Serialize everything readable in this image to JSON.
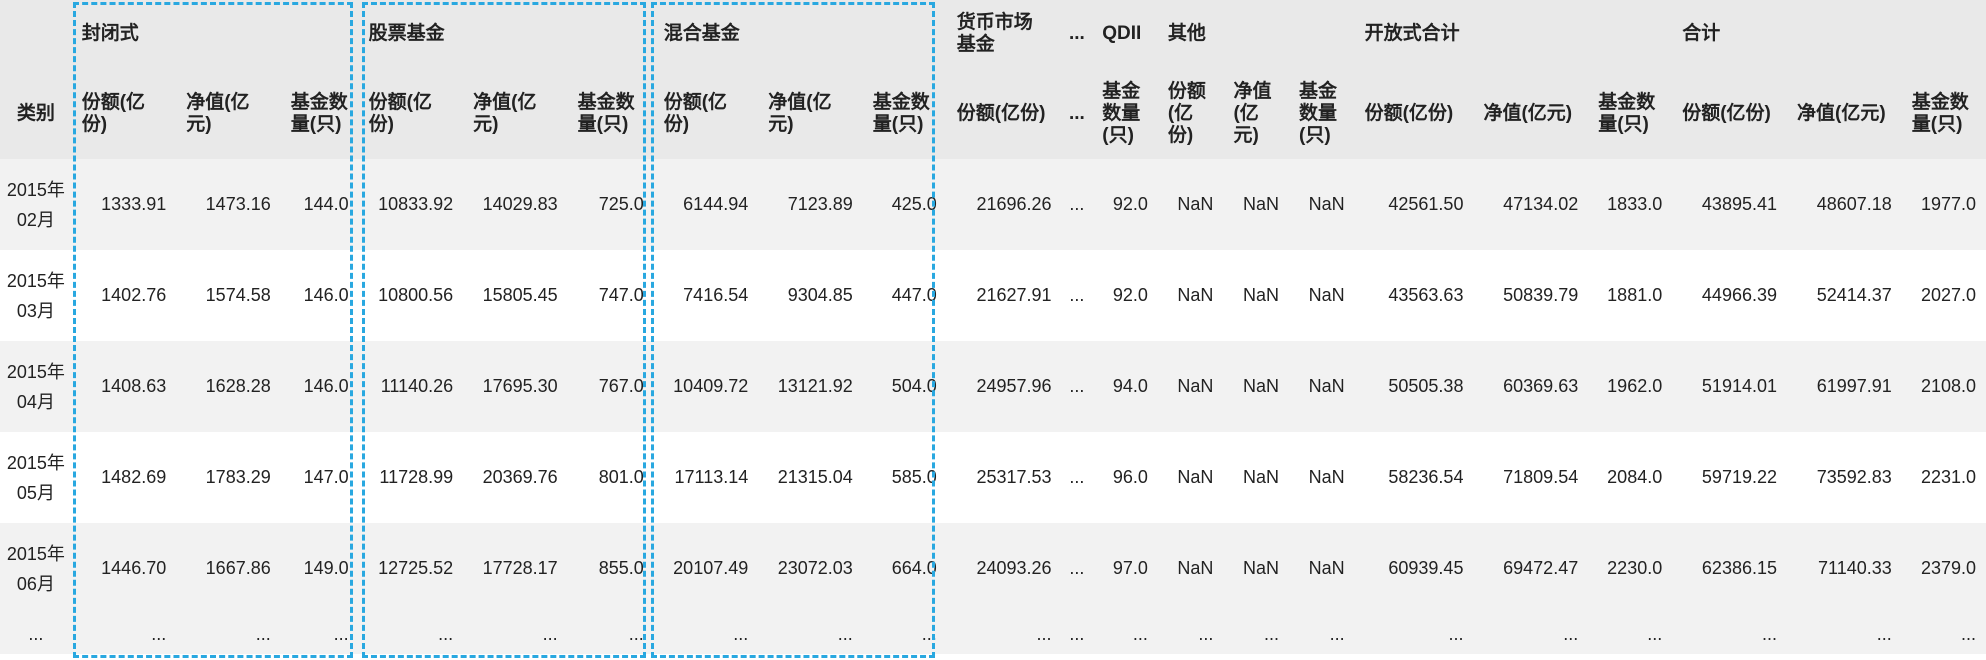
{
  "table": {
    "header_row1": [
      "",
      "封闭式",
      "",
      "",
      "股票基金",
      "",
      "",
      "混合基金",
      "",
      "",
      "货币市场基金",
      "...",
      "QDII",
      "其他",
      "",
      "",
      "开放式合计",
      "",
      "",
      "合计",
      "",
      ""
    ],
    "header_row2": [
      "类别",
      "份额(亿份)",
      "净值(亿元)",
      "基金数量(只)",
      "份额(亿份)",
      "净值(亿元)",
      "基金数量(只)",
      "份额(亿份)",
      "净值(亿元)",
      "基金数量(只)",
      "份额(亿份)",
      "...",
      "基金数量(只)",
      "份额(亿份)",
      "净值(亿元)",
      "基金数量(只)",
      "份额(亿份)",
      "净值(亿元)",
      "基金数量(只)",
      "份额(亿份)",
      "净值(亿元)",
      "基金数量(只)"
    ],
    "rows": [
      [
        "2015年02月",
        "1333.91",
        "1473.16",
        "144.0",
        "10833.92",
        "14029.83",
        "725.0",
        "6144.94",
        "7123.89",
        "425.0",
        "21696.26",
        "...",
        "92.0",
        "NaN",
        "NaN",
        "NaN",
        "42561.50",
        "47134.02",
        "1833.0",
        "43895.41",
        "48607.18",
        "1977.0"
      ],
      [
        "2015年03月",
        "1402.76",
        "1574.58",
        "146.0",
        "10800.56",
        "15805.45",
        "747.0",
        "7416.54",
        "9304.85",
        "447.0",
        "21627.91",
        "...",
        "92.0",
        "NaN",
        "NaN",
        "NaN",
        "43563.63",
        "50839.79",
        "1881.0",
        "44966.39",
        "52414.37",
        "2027.0"
      ],
      [
        "2015年04月",
        "1408.63",
        "1628.28",
        "146.0",
        "11140.26",
        "17695.30",
        "767.0",
        "10409.72",
        "13121.92",
        "504.0",
        "24957.96",
        "...",
        "94.0",
        "NaN",
        "NaN",
        "NaN",
        "50505.38",
        "60369.63",
        "1962.0",
        "51914.01",
        "61997.91",
        "2108.0"
      ],
      [
        "2015年05月",
        "1482.69",
        "1783.29",
        "147.0",
        "11728.99",
        "20369.76",
        "801.0",
        "17113.14",
        "21315.04",
        "585.0",
        "25317.53",
        "...",
        "96.0",
        "NaN",
        "NaN",
        "NaN",
        "58236.54",
        "71809.54",
        "2084.0",
        "59719.22",
        "73592.83",
        "2231.0"
      ],
      [
        "2015年06月",
        "1446.70",
        "1667.86",
        "149.0",
        "12725.52",
        "17728.17",
        "855.0",
        "20107.49",
        "23072.03",
        "664.0",
        "24093.26",
        "...",
        "97.0",
        "NaN",
        "NaN",
        "NaN",
        "60939.45",
        "69472.47",
        "2230.0",
        "62386.15",
        "71140.33",
        "2379.0"
      ]
    ],
    "ellipsis_row": [
      "...",
      "...",
      "...",
      "...",
      "...",
      "...",
      "...",
      "...",
      "...",
      "...",
      "...",
      "...",
      "...",
      "...",
      "...",
      "...",
      "...",
      "...",
      "...",
      "...",
      "...",
      "..."
    ]
  },
  "colors": {
    "header_bg": "#e9e9e9",
    "alt_row_bg": "#f2f2f2",
    "highlight_border": "#29a8e0"
  }
}
